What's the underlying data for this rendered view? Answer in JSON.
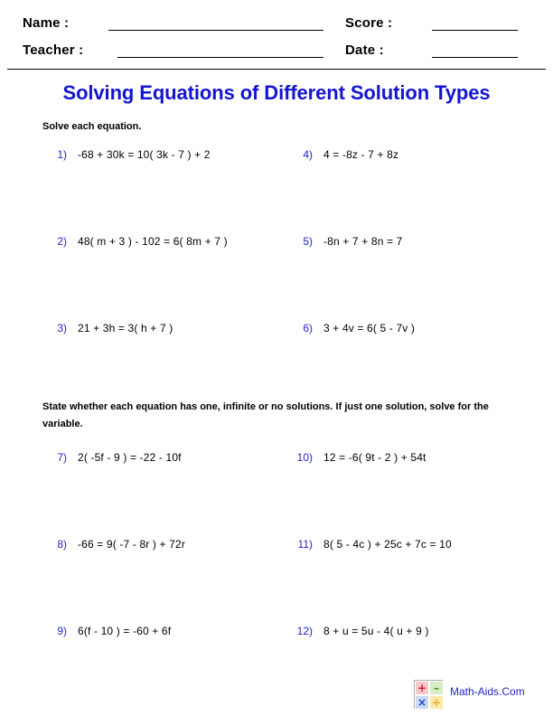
{
  "header": {
    "name_label": "Name :",
    "teacher_label": "Teacher :",
    "score_label": "Score :",
    "date_label": "Date :",
    "name_value": "",
    "teacher_value": "",
    "score_value": "",
    "date_value": ""
  },
  "title": "Solving Equations of Different Solution Types",
  "colors": {
    "title_blue": "#1414d2",
    "number_blue": "#2222cc",
    "text_black": "#000000",
    "page_background": "#ffffff"
  },
  "sections": [
    {
      "instruction": "Solve each equation.",
      "problems": [
        {
          "number": "1)",
          "equation": "-68 + 30k = 10( 3k - 7 ) + 2"
        },
        {
          "number": "2)",
          "equation": "48( m + 3 ) - 102 = 6( 8m + 7 )"
        },
        {
          "number": "3)",
          "equation": "21 + 3h = 3( h + 7 )"
        },
        {
          "number": "4)",
          "equation": "4 = -8z - 7 + 8z"
        },
        {
          "number": "5)",
          "equation": "-8n + 7 + 8n = 7"
        },
        {
          "number": "6)",
          "equation": "3 + 4v = 6( 5 - 7v )"
        }
      ]
    },
    {
      "instruction": "State whether each equation has one, infinite or no solutions. If just one solution, solve for the variable.",
      "problems": [
        {
          "number": "7)",
          "equation": "2( -5f - 9 ) = -22 - 10f"
        },
        {
          "number": "8)",
          "equation": "-66 = 9( -7 - 8r ) + 72r"
        },
        {
          "number": "9)",
          "equation": "6(f - 10 ) = -60 + 6f"
        },
        {
          "number": "10)",
          "equation": "12 = -6( 9t - 2 ) + 54t"
        },
        {
          "number": "11)",
          "equation": "8( 5 - 4c ) + 25c + 7c = 10"
        },
        {
          "number": "12)",
          "equation": "8 + u = 5u - 4( u + 9 )"
        }
      ]
    }
  ],
  "footer": {
    "site_name": "Math-Aids.Com",
    "logo_tiles": [
      "+",
      "–",
      "×",
      "÷"
    ]
  }
}
